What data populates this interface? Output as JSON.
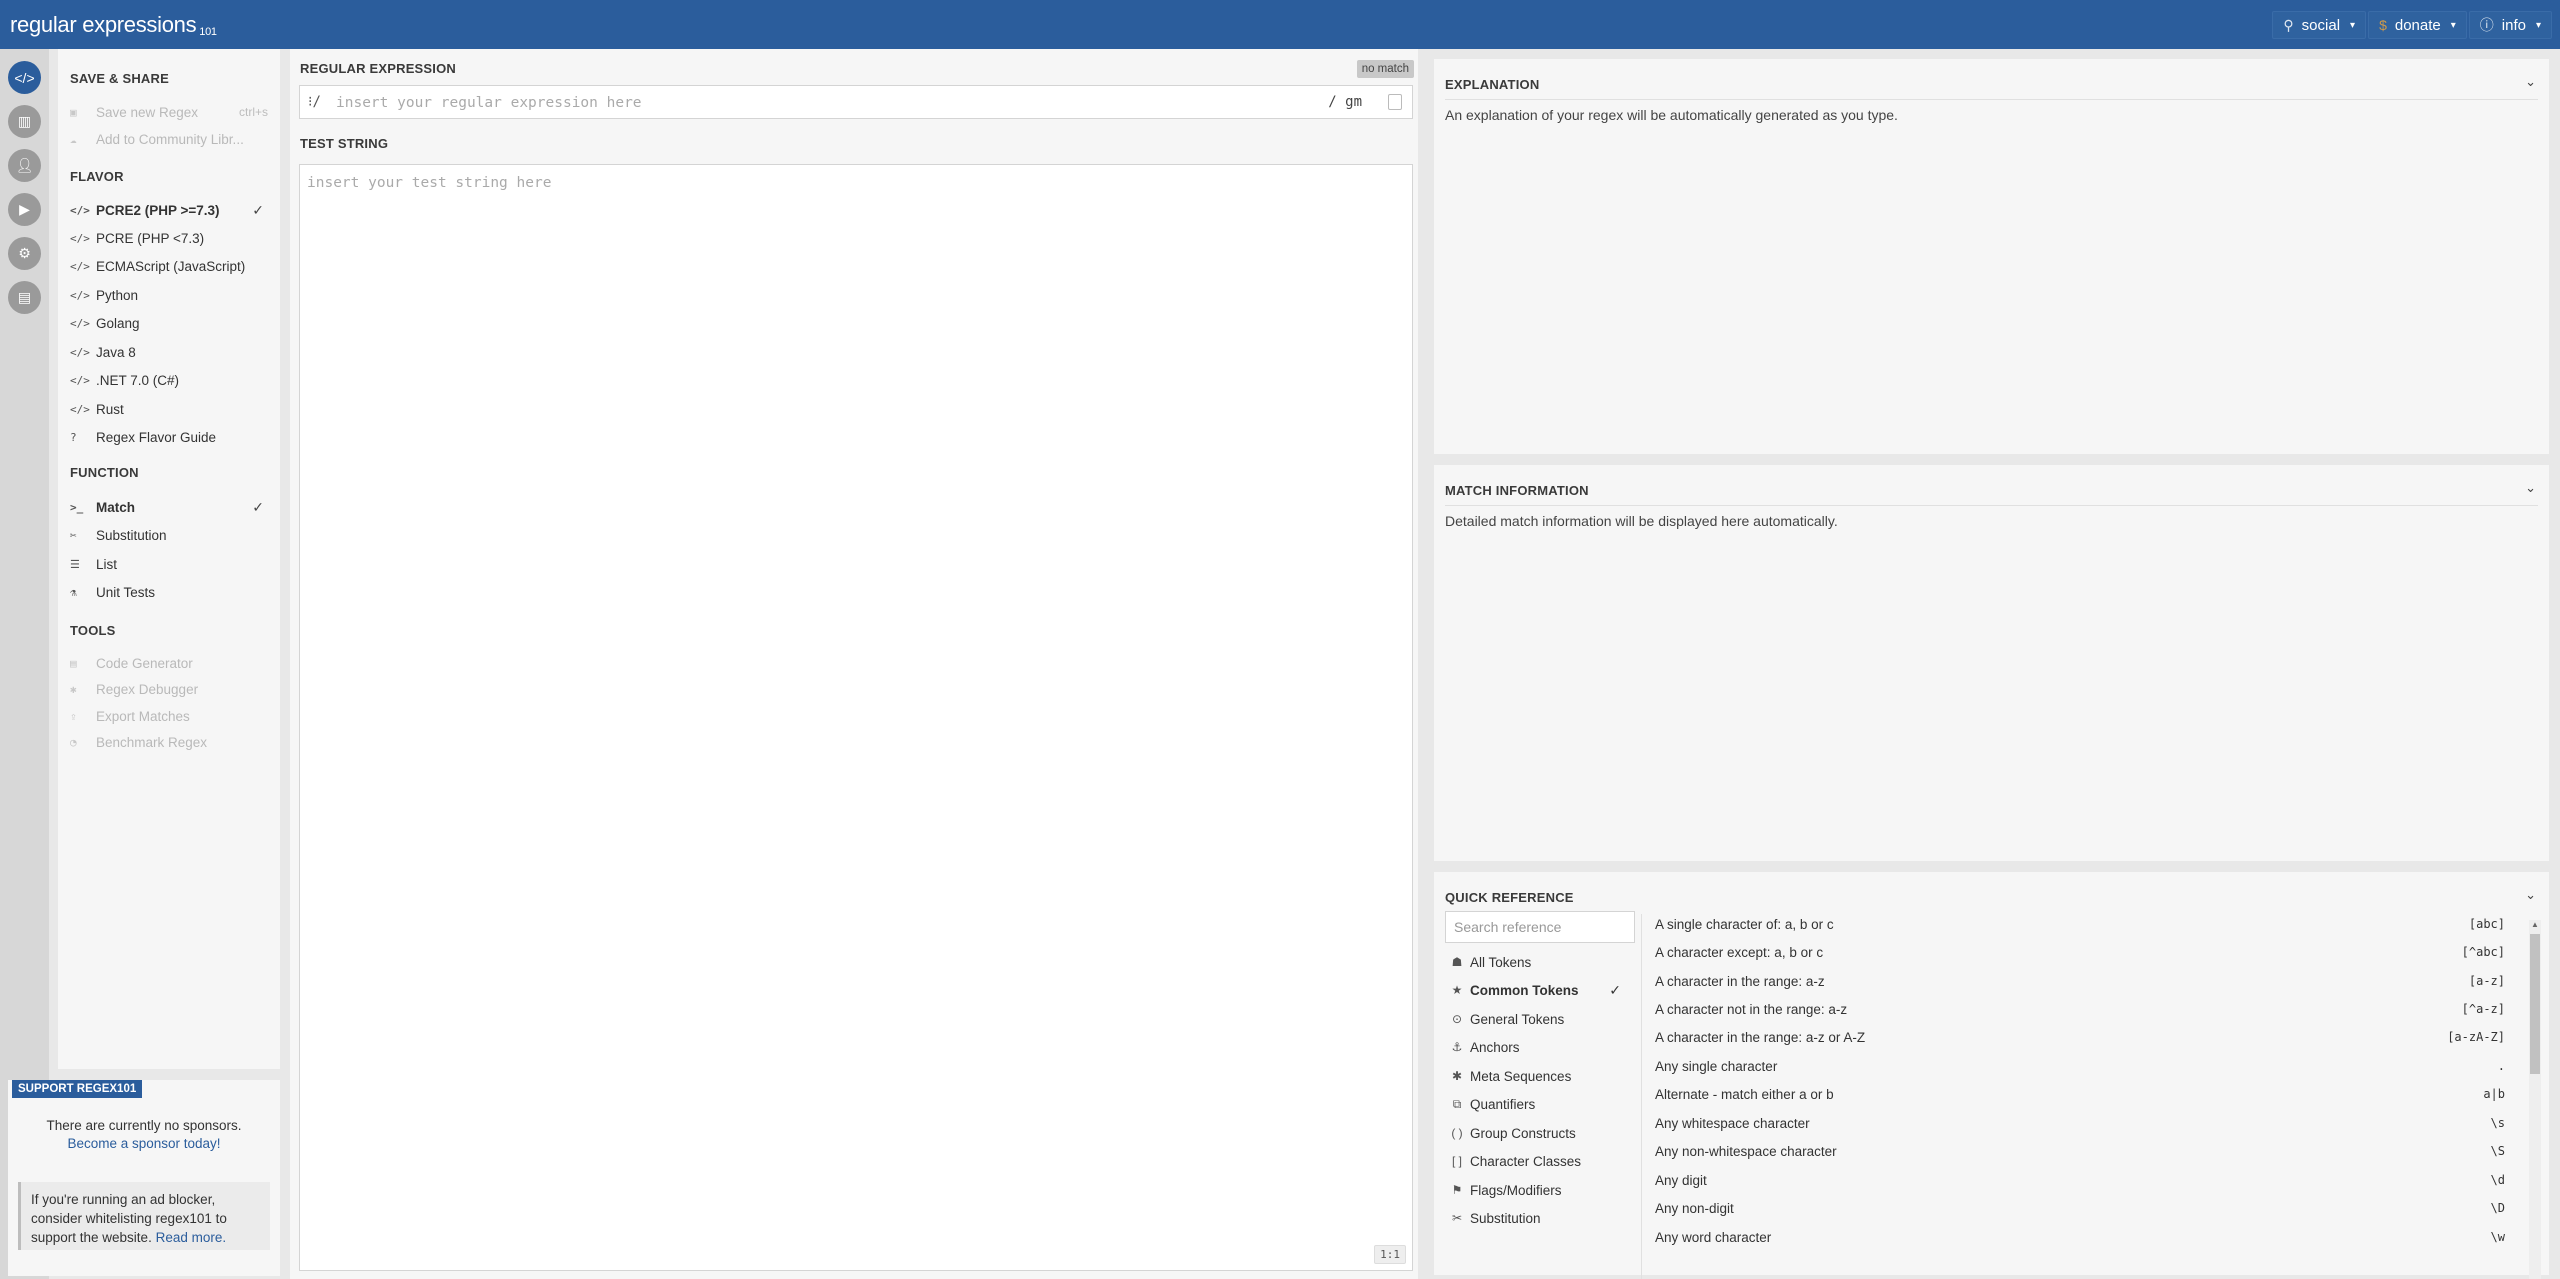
{
  "app": {
    "logo_main": "regular",
    "logo_light": " expressions",
    "logo_num": "101"
  },
  "topmenu": [
    {
      "icon": "⚲",
      "label": "social"
    },
    {
      "icon": "$",
      "label": "donate"
    },
    {
      "icon": "ⓘ",
      "label": "info"
    }
  ],
  "sidebar": {
    "save_share_title": "SAVE & SHARE",
    "save_items": [
      {
        "label": "Save new Regex",
        "shortcut": "ctrl+s"
      },
      {
        "label": "Add to Community Libr..."
      }
    ],
    "flavor_title": "FLAVOR",
    "flavors": [
      {
        "label": "PCRE2 (PHP >=7.3)"
      },
      {
        "label": "PCRE (PHP <7.3)"
      },
      {
        "label": "ECMAScript (JavaScript)"
      },
      {
        "label": "Python"
      },
      {
        "label": "Golang"
      },
      {
        "label": "Java 8"
      },
      {
        "label": ".NET 7.0 (C#)"
      },
      {
        "label": "Rust"
      },
      {
        "label": "Regex Flavor Guide"
      }
    ],
    "function_title": "FUNCTION",
    "functions": [
      {
        "label": "Match"
      },
      {
        "label": "Substitution"
      },
      {
        "label": "List"
      },
      {
        "label": "Unit Tests"
      }
    ],
    "tools_title": "TOOLS",
    "tools": [
      {
        "label": "Code Generator"
      },
      {
        "label": "Regex Debugger"
      },
      {
        "label": "Export Matches"
      },
      {
        "label": "Benchmark Regex"
      }
    ],
    "checkmark": "✓"
  },
  "sponsor": {
    "tag": "SUPPORT REGEX101",
    "text": "There are currently no sponsors.",
    "link": "Become a sponsor today!",
    "adblock_text": "If you're running an ad blocker, consider whitelisting regex101 to support the website.",
    "adblock_link": "Read more."
  },
  "editor": {
    "regex_title": "REGULAR EXPRESSION",
    "no_match": "no match",
    "delimiter_open": "⁝/",
    "regex_placeholder": "insert your regular expression here",
    "flags": "/ gm",
    "test_title": "TEST STRING",
    "test_placeholder": "insert your test string here",
    "ratio": "1:1"
  },
  "explanation": {
    "title": "EXPLANATION",
    "text": "An explanation of your regex will be automatically generated as you type."
  },
  "match_info": {
    "title": "MATCH INFORMATION",
    "text": "Detailed match information will be displayed here automatically."
  },
  "quick_reference": {
    "title": "QUICK REFERENCE",
    "search_placeholder": "Search reference",
    "categories": [
      {
        "icon": "☗",
        "label": "All Tokens"
      },
      {
        "icon": "★",
        "label": "Common Tokens"
      },
      {
        "icon": "⊙",
        "label": "General Tokens"
      },
      {
        "icon": "⚓",
        "label": "Anchors"
      },
      {
        "icon": "✱",
        "label": "Meta Sequences"
      },
      {
        "icon": "⧉",
        "label": "Quantifiers"
      },
      {
        "icon": "( )",
        "label": "Group Constructs"
      },
      {
        "icon": "[ ]",
        "label": "Character Classes"
      },
      {
        "icon": "⚑",
        "label": "Flags/Modifiers"
      },
      {
        "icon": "✂",
        "label": "Substitution"
      }
    ],
    "tokens": [
      {
        "desc": "A single character of: a, b or c",
        "code": "[abc]"
      },
      {
        "desc": "A character except: a, b or c",
        "code": "[^abc]"
      },
      {
        "desc": "A character in the range: a-z",
        "code": "[a-z]"
      },
      {
        "desc": "A character not in the range: a-z",
        "code": "[^a-z]"
      },
      {
        "desc": "A character in the range: a-z or A-Z",
        "code": "[a-zA-Z]"
      },
      {
        "desc": "Any single character",
        "code": "."
      },
      {
        "desc": "Alternate - match either a or b",
        "code": "a|b"
      },
      {
        "desc": "Any whitespace character",
        "code": "\\s"
      },
      {
        "desc": "Any non-whitespace character",
        "code": "\\S"
      },
      {
        "desc": "Any digit",
        "code": "\\d"
      },
      {
        "desc": "Any non-digit",
        "code": "\\D"
      },
      {
        "desc": "Any word character",
        "code": "\\w"
      }
    ]
  }
}
